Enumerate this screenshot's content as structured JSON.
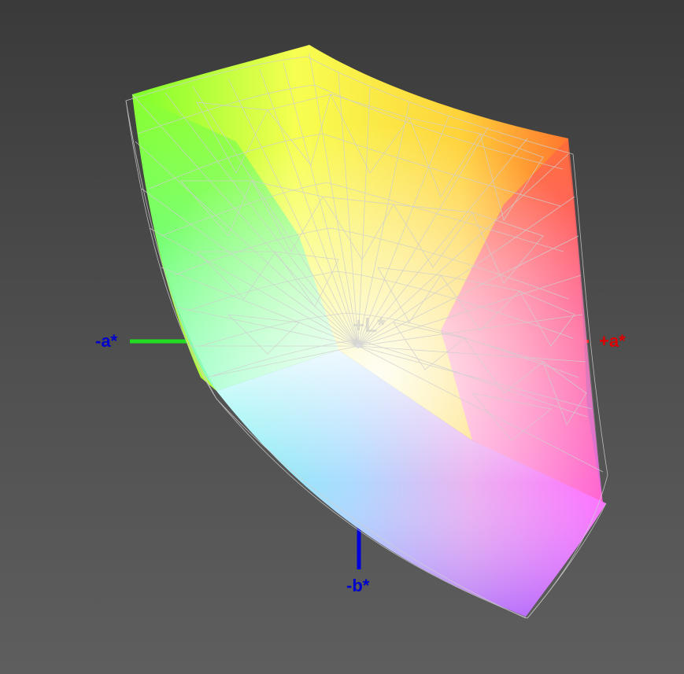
{
  "axes": {
    "minus_a": {
      "label": "-a*",
      "color": "#0000cc"
    },
    "plus_a": {
      "label": "+a*",
      "color": "#dd0000"
    },
    "minus_b": {
      "label": "-b*",
      "color": "#0000cc"
    },
    "plus_l": {
      "label": "+L*",
      "color": "#c8c8c8"
    }
  },
  "colors": {
    "background_top": "#3a3a3a",
    "background_bottom": "#5e5e5e",
    "green_axis": "#22dd22",
    "red_axis": "#ff2222",
    "blue_axis": "#0000dd",
    "wireframe": "#c8c8c8"
  }
}
